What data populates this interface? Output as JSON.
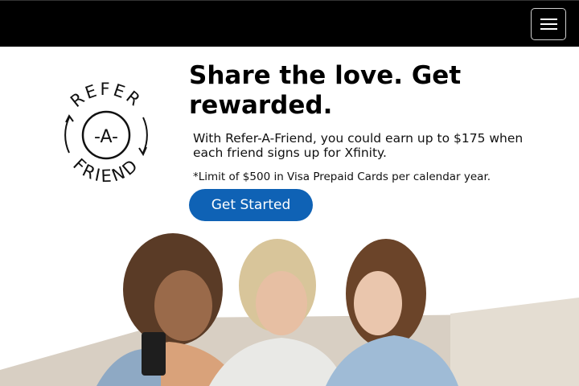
{
  "navbar": {
    "menu_icon": "hamburger-menu-icon"
  },
  "logo": {
    "top_text": "REFER",
    "middle_text": "-A-",
    "bottom_text": "FRIEND"
  },
  "hero": {
    "headline": "Share the love. Get rewarded.",
    "lead": "With Refer-A-Friend, you could earn up to $175 when each friend signs up for Xfinity.",
    "fineprint": "*Limit of $500 in Visa Prepaid Cards per calendar year.",
    "cta_label": "Get Started"
  },
  "photo": {
    "subject": "three friends smiling on a couch looking at a phone"
  },
  "colors": {
    "navbar": "#000000",
    "cta": "#0f62b5"
  }
}
